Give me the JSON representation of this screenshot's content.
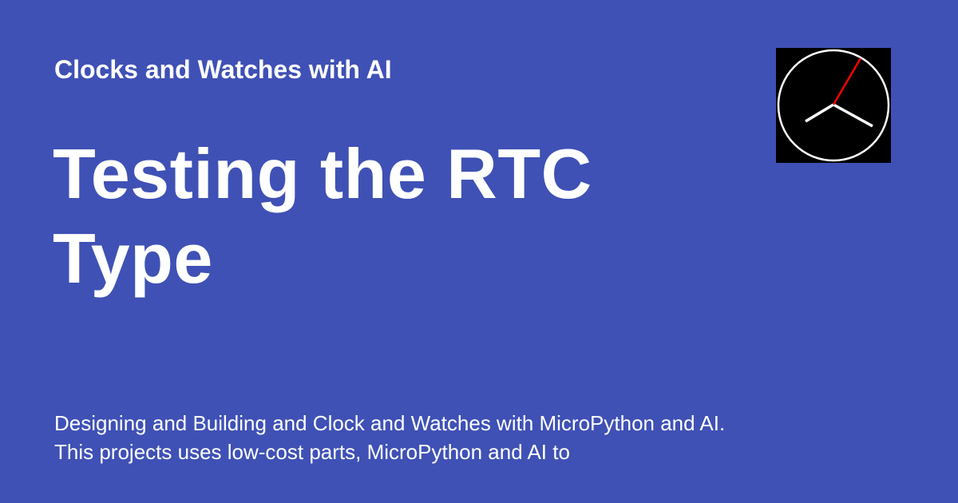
{
  "site": {
    "title": "Clocks and Watches with AI"
  },
  "page": {
    "title": "Testing the RTC Type",
    "description": "Designing and Building and Clock and Watches with MicroPython and AI.  This projects uses low-cost parts, MicroPython and AI to"
  },
  "logo": {
    "icon": "analog-clock-icon",
    "colors": {
      "background": "#000000",
      "face": "#ffffff",
      "hands": "#ffffff",
      "second_hand": "#ff0000"
    }
  },
  "colors": {
    "background": "#3f51b5",
    "text": "#ffffff"
  }
}
